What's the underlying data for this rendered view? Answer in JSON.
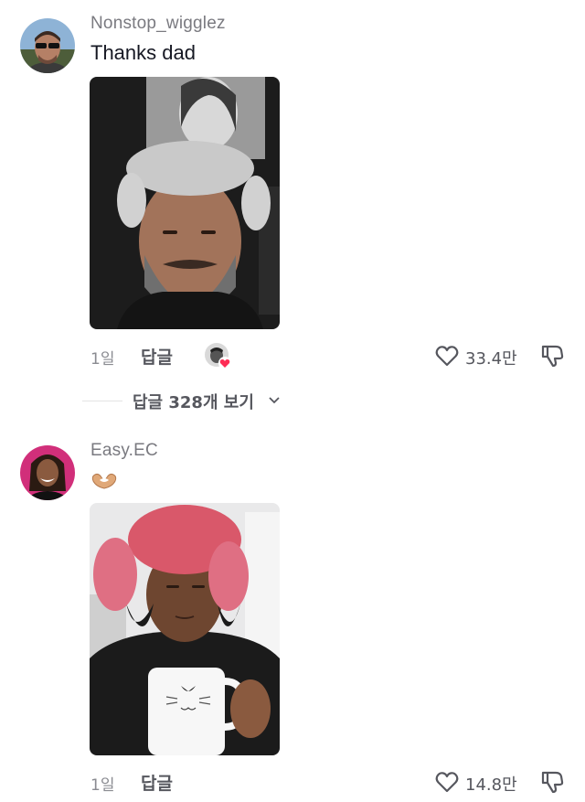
{
  "comments": [
    {
      "username": "Nonstop_wigglez",
      "text": "Thanks dad",
      "time": "1일",
      "reply_label": "답글",
      "likes": "33.4만",
      "creator_liked": true
    },
    {
      "username": "Easy.EC",
      "text": "",
      "emoji": "heart-hands",
      "time": "1일",
      "reply_label": "답글",
      "likes": "14.8만",
      "creator_liked": false
    }
  ],
  "view_replies": {
    "label": "답글 328개 보기"
  },
  "colors": {
    "username": "#7a7a80",
    "secondary": "#56575e",
    "heart_badge": "#fe2c55"
  }
}
